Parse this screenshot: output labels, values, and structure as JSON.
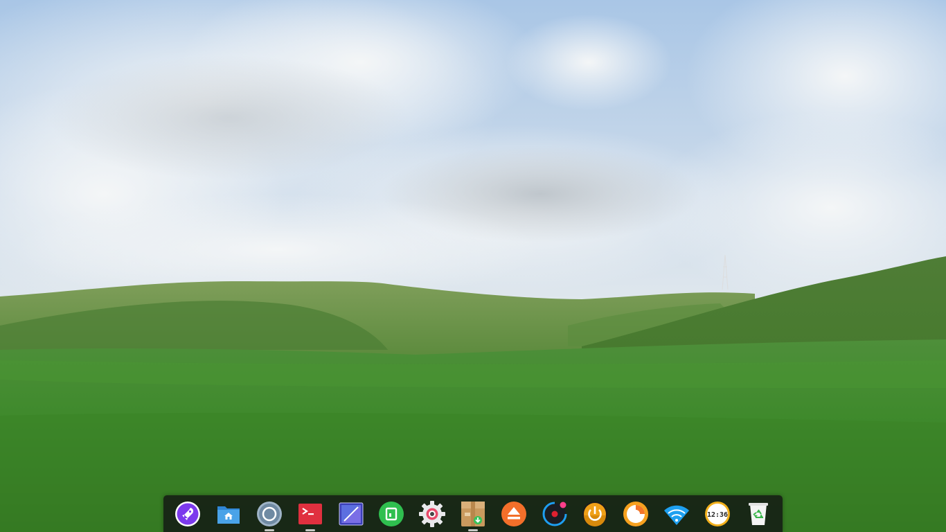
{
  "desktop": {
    "wallpaper": "green-hills-cloudy-sky"
  },
  "dock": {
    "items": [
      {
        "icon": "launcher-rocket-icon",
        "running": false
      },
      {
        "icon": "file-manager-folder-icon",
        "running": false
      },
      {
        "icon": "browser-circle-icon",
        "running": true
      },
      {
        "icon": "terminal-icon",
        "running": true
      },
      {
        "icon": "screenshot-editor-icon",
        "running": false
      },
      {
        "icon": "app-store-icon",
        "running": false
      },
      {
        "icon": "system-settings-gear-icon",
        "running": false
      },
      {
        "icon": "package-installer-icon",
        "running": true
      },
      {
        "icon": "eject-icon",
        "running": false
      },
      {
        "icon": "screen-recorder-icon",
        "running": false
      },
      {
        "icon": "power-icon",
        "running": false
      },
      {
        "icon": "orange-circle-app-icon",
        "running": false
      },
      {
        "icon": "wifi-icon",
        "running": false
      },
      {
        "icon": "clock-icon",
        "running": false
      },
      {
        "icon": "trash-icon",
        "running": false
      }
    ],
    "clock_text": "12:36"
  },
  "colors": {
    "sky": "#a9c6e6",
    "grass": "#3f8a2c",
    "dock_bg": "#121614",
    "launcher_purple": "#7c3aed",
    "folder_blue": "#4aa3e8",
    "terminal_red": "#e0303f",
    "appstore_green": "#2fbf4f",
    "eject_orange": "#f36f2a",
    "power_orange": "#f0a018",
    "wifi_blue": "#1ea0f0"
  }
}
